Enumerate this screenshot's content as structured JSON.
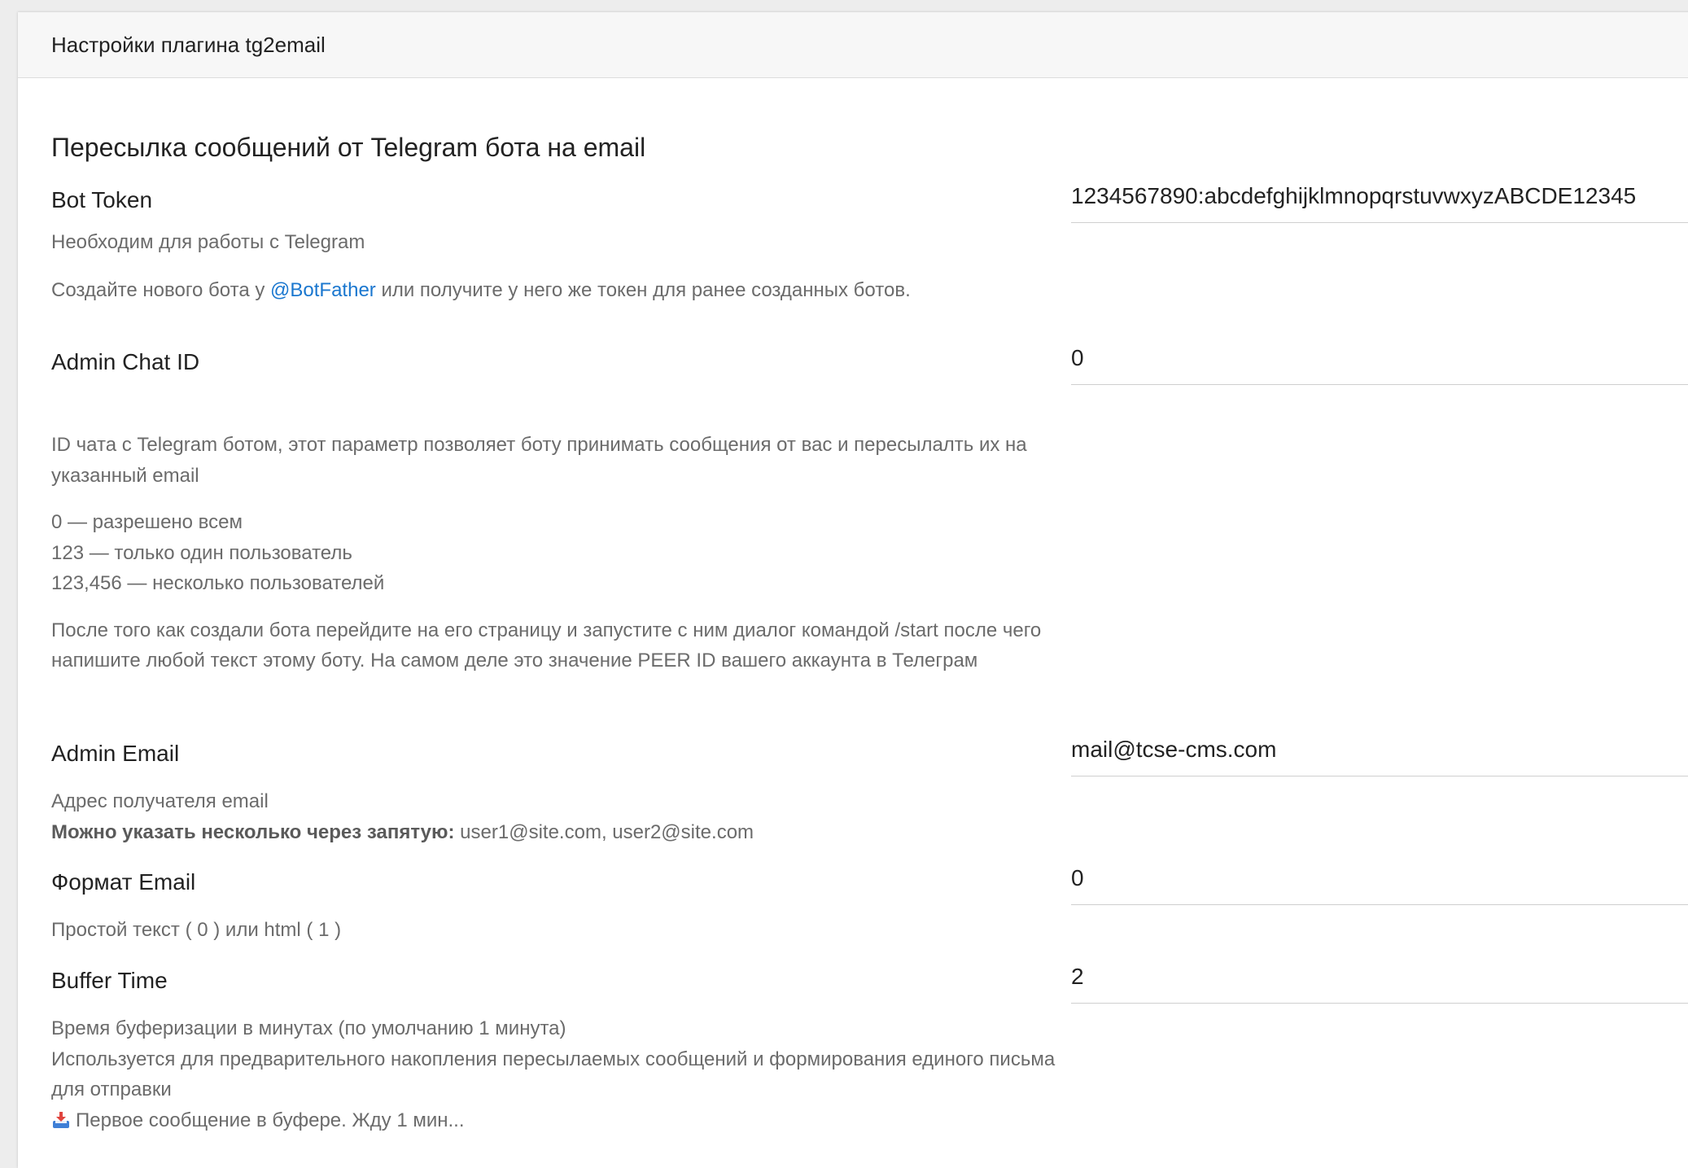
{
  "header": {
    "title": "Настройки плагина tg2email"
  },
  "section": {
    "title": "Пересылка сообщений от Telegram бота на email"
  },
  "bot_token": {
    "label": "Bot Token",
    "value": "1234567890:abcdefghijklmnopqrstuvwxyzABCDE12345",
    "desc_line1": "Необходим для работы с Telegram",
    "desc_line2_prefix": "Создайте нового бота у ",
    "desc_line2_link": "@BotFather",
    "desc_line2_suffix": " или получите у него же токен для ранее созданных ботов."
  },
  "admin_chat_id": {
    "label": "Admin Chat ID",
    "value": "0",
    "desc_p1": "ID чата с Telegram ботом, этот параметр позволяет боту принимать сообщения от вас и пересылалть их на указанный email",
    "desc_list": [
      "0 — разрешено всем",
      "123 — только один пользователь",
      "123,456 — несколько пользователей"
    ],
    "desc_p3": "После того как создали бота перейдите на его страницу и запустите с ним диалог командой /start после чего напишите любой текст этому боту. На самом деле это значение PEER ID вашего аккаунта в Телеграм"
  },
  "admin_email": {
    "label": "Admin Email",
    "value": "mail@tcse-cms.com",
    "desc_line1": "Адрес получателя email",
    "desc_bold": "Можно указать несколько через запятую:",
    "desc_examples": " user1@site.com, user2@site.com"
  },
  "email_format": {
    "label": "Формат Email",
    "value": "0",
    "desc": "Простой текст ( 0 ) или html ( 1 )"
  },
  "buffer_time": {
    "label": "Buffer Time",
    "value": "2",
    "desc_line1": "Время буферизации в минутах (по умолчанию 1 минута)",
    "desc_line2": "Используется для предварительного накопления пересылаемых сообщений и формирования единого письма для отправки",
    "desc_line3": "Первое сообщение в буфере. Жду 1 мин...",
    "desc_line3_icon": "inbox-tray-icon"
  },
  "colors": {
    "link": "#1a77cf",
    "muted_text": "#6b6b6b",
    "header_bg": "#f7f7f7"
  }
}
